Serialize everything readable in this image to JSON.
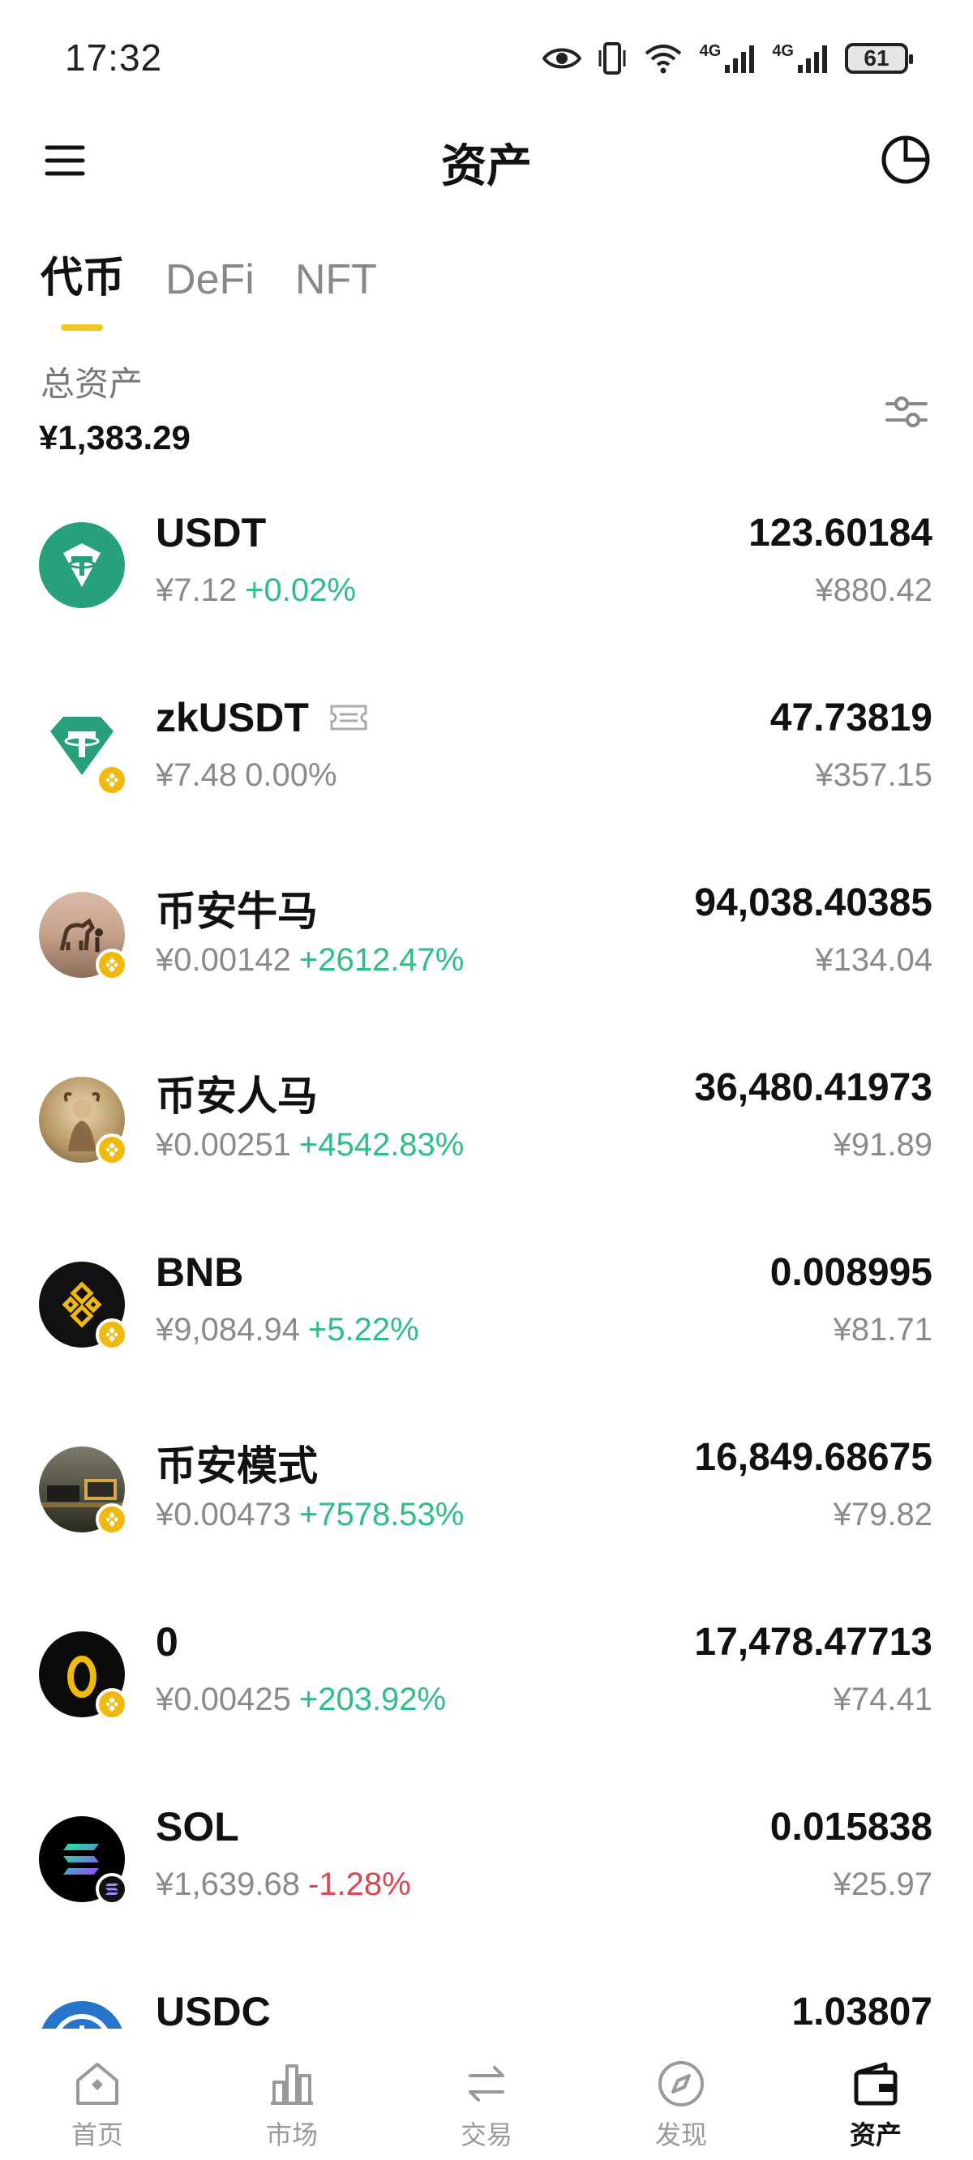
{
  "status_bar": {
    "time": "17:32",
    "network_1": "4G",
    "network_2": "4G",
    "battery": "61"
  },
  "header": {
    "title": "资产"
  },
  "tabs": [
    {
      "label": "代币",
      "active": true
    },
    {
      "label": "DeFi",
      "active": false
    },
    {
      "label": "NFT",
      "active": false
    }
  ],
  "total": {
    "label": "总资产",
    "value": "¥1,383.29"
  },
  "assets": [
    {
      "name": "USDT",
      "price": "¥7.12",
      "change": "+0.02%",
      "change_dir": "up",
      "amount": "123.60184",
      "value": "¥880.42",
      "icon": "tether-icon",
      "badge": ""
    },
    {
      "name": "zkUSDT",
      "price": "¥7.48",
      "change": "0.00%",
      "change_dir": "flat",
      "amount": "47.73819",
      "value": "¥357.15",
      "icon": "tether-icon",
      "badge": "bnb-chain-badge"
    },
    {
      "name": "币安牛马",
      "price": "¥0.00142",
      "change": "+2612.47%",
      "change_dir": "up",
      "amount": "94,038.40385",
      "value": "¥134.04",
      "icon": "horse-photo-icon",
      "badge": "bnb-chain-badge"
    },
    {
      "name": "币安人马",
      "price": "¥0.00251",
      "change": "+4542.83%",
      "change_dir": "up",
      "amount": "36,480.41973",
      "value": "¥91.89",
      "icon": "centaur-art-icon",
      "badge": "bnb-chain-badge"
    },
    {
      "name": "BNB",
      "price": "¥9,084.94",
      "change": "+5.22%",
      "change_dir": "up",
      "amount": "0.008995",
      "value": "¥81.71",
      "icon": "bnb-icon",
      "badge": "bnb-chain-badge"
    },
    {
      "name": "币安模式",
      "price": "¥0.00473",
      "change": "+7578.53%",
      "change_dir": "up",
      "amount": "16,849.68675",
      "value": "¥79.82",
      "icon": "room-photo-icon",
      "badge": "bnb-chain-badge"
    },
    {
      "name": "0",
      "price": "¥0.00425",
      "change": "+203.92%",
      "change_dir": "up",
      "amount": "17,478.47713",
      "value": "¥74.41",
      "icon": "zero-token-icon",
      "badge": "bnb-chain-badge"
    },
    {
      "name": "SOL",
      "price": "¥1,639.68",
      "change": "-1.28%",
      "change_dir": "down",
      "amount": "0.015838",
      "value": "¥25.97",
      "icon": "solana-icon",
      "badge": "solana-chain-badge"
    },
    {
      "name": "USDC",
      "price": "",
      "change": "",
      "change_dir": "flat",
      "amount": "1.03807",
      "value": "",
      "icon": "usdc-icon",
      "badge": ""
    }
  ],
  "nav": [
    {
      "label": "首页",
      "icon": "home-icon",
      "active": false
    },
    {
      "label": "市场",
      "icon": "market-chart-icon",
      "active": false
    },
    {
      "label": "交易",
      "icon": "swap-icon",
      "active": false
    },
    {
      "label": "发现",
      "icon": "compass-icon",
      "active": false
    },
    {
      "label": "资产",
      "icon": "wallet-icon",
      "active": true
    }
  ],
  "colors": {
    "accent": "#f0c91e",
    "up": "#2ebd85",
    "down": "#e0454f",
    "muted": "#8a8a8a"
  }
}
